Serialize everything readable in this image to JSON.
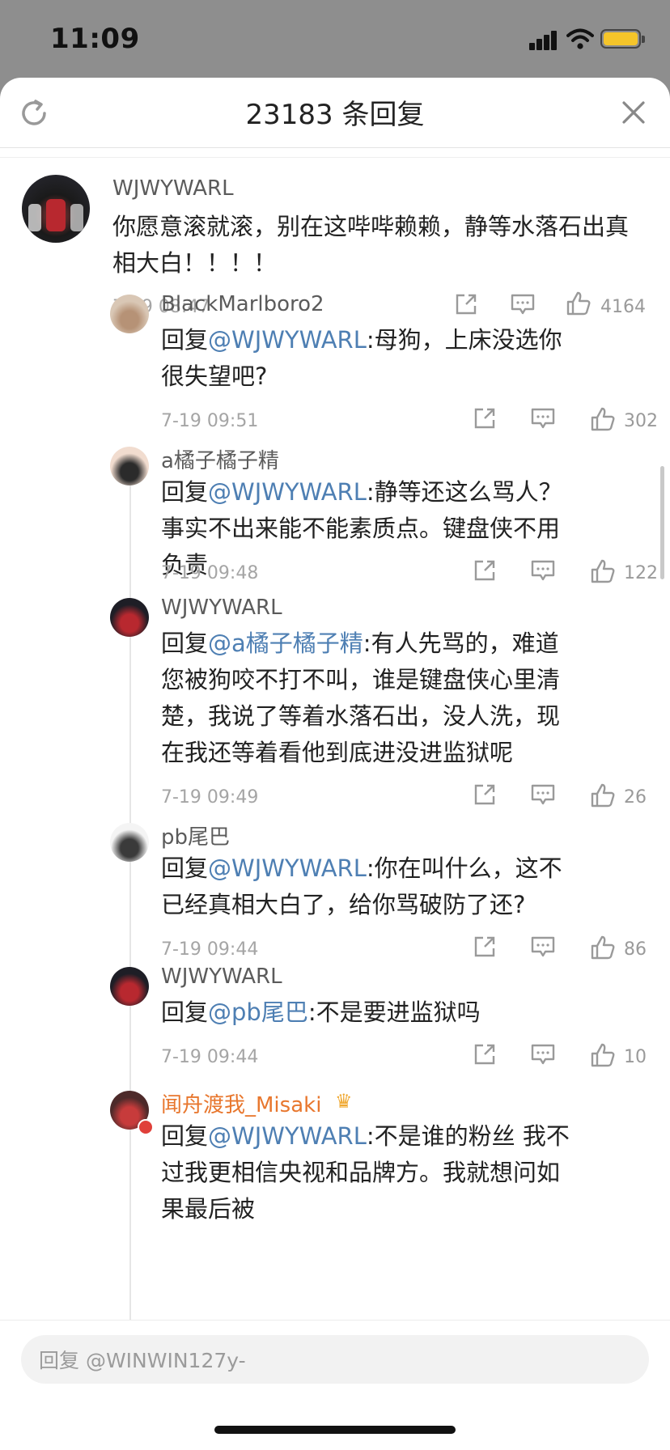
{
  "status_bar": {
    "time": "11:09"
  },
  "header": {
    "title": "23183 条回复",
    "refresh_icon": "refresh-icon",
    "close_icon": "close-icon"
  },
  "main_comment": {
    "username": "WJWYWARL",
    "text": "你愿意滚就滚，别在这哔哔赖赖，静等水落石出真相大白！！！！",
    "time": "7-19 08:47",
    "likes": "4164"
  },
  "replies": [
    {
      "username": "BlackMarlboro2",
      "prefix": "回复",
      "mention": "@WJWYWARL",
      "text": ":母狗，上床没选你很失望吧?",
      "time": "7-19 09:51",
      "likes": "302"
    },
    {
      "username": "a橘子橘子精",
      "prefix": "回复",
      "mention": "@WJWYWARL",
      "text": ":静等还这么骂人？事实不出来能不能素质点。键盘侠不用负责",
      "time": "7-19 09:48",
      "likes": "122"
    },
    {
      "username": "WJWYWARL",
      "prefix": "回复",
      "mention": "@a橘子橘子精",
      "text": ":有人先骂的，难道您被狗咬不打不叫，谁是键盘侠心里清楚，我说了等着水落石出，没人洗，现在我还等着看他到底进没进监狱呢",
      "time": "7-19 09:49",
      "likes": "26"
    },
    {
      "username": "pb尾巴",
      "prefix": "回复",
      "mention": "@WJWYWARL",
      "text": ":你在叫什么，这不已经真相大白了，给你骂破防了还?",
      "time": "7-19 09:44",
      "likes": "86"
    },
    {
      "username": "WJWYWARL",
      "prefix": "回复",
      "mention": "@pb尾巴",
      "text": ":不是要进监狱吗",
      "time": "7-19 09:44",
      "likes": "10"
    },
    {
      "username": "闻舟渡我_Misaki",
      "prefix": "回复",
      "mention": "@WJWYWARL",
      "text": ":不是谁的粉丝 我不过我更相信央视和品牌方。我就想问如果最后被",
      "time": "",
      "likes": ""
    }
  ],
  "reply_input": {
    "placeholder": "回复 @WINWIN127y-"
  },
  "colors": {
    "mention": "#4e7fb3",
    "vip_name": "#e8772e",
    "battery": "#f5c52a"
  }
}
